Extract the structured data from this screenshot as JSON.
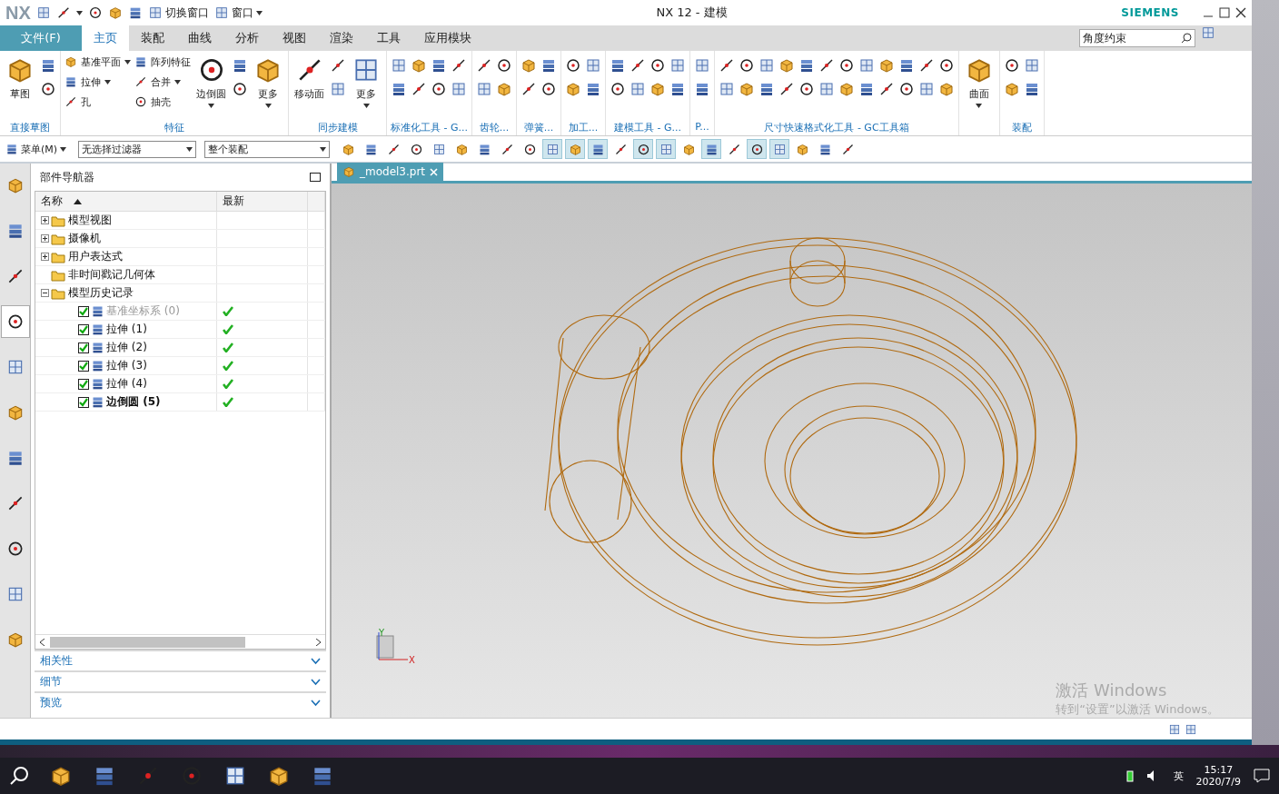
{
  "title_bar": {
    "logo": "NX",
    "title": "NX 12 - 建模",
    "brand": "SIEMENS",
    "quick_access": [
      {
        "label": "切换窗口",
        "dropdown": false
      },
      {
        "label": "窗口",
        "dropdown": true
      }
    ]
  },
  "ribbon": {
    "file_tab": "文件(F)",
    "tabs": [
      {
        "label": "主页",
        "selected": true
      },
      {
        "label": "装配",
        "selected": false
      },
      {
        "label": "曲线",
        "selected": false
      },
      {
        "label": "分析",
        "selected": false
      },
      {
        "label": "视图",
        "selected": false
      },
      {
        "label": "渲染",
        "selected": false
      },
      {
        "label": "工具",
        "selected": false
      },
      {
        "label": "应用模块",
        "selected": false
      }
    ],
    "search": {
      "value": "角度约束"
    },
    "groups": [
      {
        "label": "直接草图",
        "columns": [
          {
            "kind": "large",
            "label": "草图",
            "dropdown": false
          },
          {
            "kind": "icons"
          }
        ]
      },
      {
        "label": "特征",
        "columns": [
          {
            "kind": "small",
            "items": [
              {
                "label": "基准平面",
                "dropdown": true
              },
              {
                "label": "拉伸",
                "dropdown": true
              },
              {
                "label": "孔",
                "dropdown": false
              }
            ]
          },
          {
            "kind": "small",
            "items": [
              {
                "label": "阵列特征",
                "dropdown": false
              },
              {
                "label": "合并",
                "dropdown": true
              },
              {
                "label": "抽壳",
                "dropdown": false
              }
            ]
          },
          {
            "kind": "large",
            "label": "边倒圆",
            "dropdown": true
          },
          {
            "kind": "icons"
          },
          {
            "kind": "large",
            "label": "更多",
            "dropdown": true
          }
        ]
      },
      {
        "label": "同步建模",
        "columns": [
          {
            "kind": "large",
            "label": "移动面",
            "dropdown": false
          },
          {
            "kind": "icons"
          },
          {
            "kind": "large",
            "label": "更多",
            "dropdown": true
          }
        ]
      },
      {
        "label": "标准化工具 - G...",
        "columns": [
          {
            "kind": "icons"
          },
          {
            "kind": "icons"
          },
          {
            "kind": "icons"
          },
          {
            "kind": "icons"
          }
        ]
      },
      {
        "label": "齿轮...",
        "columns": [
          {
            "kind": "icons"
          },
          {
            "kind": "icons"
          }
        ]
      },
      {
        "label": "弹簧...",
        "columns": [
          {
            "kind": "icons"
          },
          {
            "kind": "icons"
          }
        ]
      },
      {
        "label": "加工...",
        "columns": [
          {
            "kind": "icons"
          },
          {
            "kind": "icons"
          }
        ]
      },
      {
        "label": "建模工具 - G...",
        "columns": [
          {
            "kind": "icons"
          },
          {
            "kind": "icons"
          },
          {
            "kind": "icons"
          },
          {
            "kind": "icons"
          }
        ]
      },
      {
        "label": "P...",
        "columns": [
          {
            "kind": "icons"
          }
        ]
      },
      {
        "label": "尺寸快速格式化工具 - GC工具箱",
        "columns": [
          {
            "kind": "icons"
          },
          {
            "kind": "icons"
          },
          {
            "kind": "icons"
          },
          {
            "kind": "icons"
          },
          {
            "kind": "icons"
          },
          {
            "kind": "icons"
          },
          {
            "kind": "icons"
          },
          {
            "kind": "icons"
          },
          {
            "kind": "icons"
          },
          {
            "kind": "icons"
          },
          {
            "kind": "icons"
          },
          {
            "kind": "icons"
          }
        ]
      },
      {
        "columns": [
          {
            "kind": "large",
            "label": "曲面",
            "dropdown": true
          }
        ]
      },
      {
        "label": "装配",
        "columns": [
          {
            "kind": "icons"
          },
          {
            "kind": "icons"
          }
        ]
      }
    ]
  },
  "toolbar": {
    "menu": "菜单(M)",
    "filter": "无选择过滤器",
    "scope": "整个装配",
    "tools": [
      {
        "on": false
      },
      {
        "on": false
      },
      {
        "on": false
      },
      {
        "on": false
      },
      {
        "on": false
      },
      {
        "on": false
      },
      {
        "on": false
      },
      {
        "on": false
      },
      {
        "on": false
      },
      {
        "on": true
      },
      {
        "on": true
      },
      {
        "on": true
      },
      {
        "on": false
      },
      {
        "on": true
      },
      {
        "on": true
      },
      {
        "on": false
      },
      {
        "on": true
      },
      {
        "on": false
      },
      {
        "on": true
      },
      {
        "on": true
      },
      {
        "on": false
      },
      {
        "on": false
      },
      {
        "on": false
      }
    ]
  },
  "resource_bar": [
    {
      "selected": false
    },
    {
      "selected": false
    },
    {
      "selected": false
    },
    {
      "selected": true
    },
    {
      "selected": false
    },
    {
      "selected": false
    },
    {
      "selected": false
    },
    {
      "selected": false
    },
    {
      "selected": false
    },
    {
      "selected": false
    },
    {
      "selected": false
    }
  ],
  "navigator": {
    "title": "部件导航器",
    "columns": [
      "名称",
      "最新"
    ],
    "tree": [
      {
        "label": "模型视图",
        "expanded": false
      },
      {
        "label": "摄像机",
        "expanded": false
      },
      {
        "label": "用户表达式",
        "expanded": false
      },
      {
        "label": "非时间戳记几何体"
      },
      {
        "label": "模型历史记录",
        "expanded": true,
        "children": [
          {
            "label": "基准坐标系 (0)",
            "checked": true,
            "latest": true,
            "disabled": true,
            "current": false
          },
          {
            "label": "拉伸 (1)",
            "checked": true,
            "latest": true,
            "disabled": false,
            "current": false
          },
          {
            "label": "拉伸 (2)",
            "checked": true,
            "latest": true,
            "disabled": false,
            "current": false
          },
          {
            "label": "拉伸 (3)",
            "checked": true,
            "latest": true,
            "disabled": false,
            "current": false
          },
          {
            "label": "拉伸 (4)",
            "checked": true,
            "latest": true,
            "disabled": false,
            "current": false
          },
          {
            "label": "边倒圆 (5)",
            "checked": true,
            "latest": true,
            "disabled": false,
            "current": true
          }
        ]
      }
    ],
    "panels": [
      {
        "label": "相关性",
        "expanded": false
      },
      {
        "label": "细节",
        "expanded": false
      },
      {
        "label": "预览",
        "expanded": false
      }
    ]
  },
  "viewport": {
    "tab": "_model3.prt",
    "axes": [
      "Y",
      "X"
    ]
  },
  "activation": {
    "title": "激活 Windows",
    "hint": "转到“设置”以激活 Windows。"
  },
  "taskbar": {
    "ime": "英",
    "time": "15:17",
    "date": "2020/7/9"
  }
}
